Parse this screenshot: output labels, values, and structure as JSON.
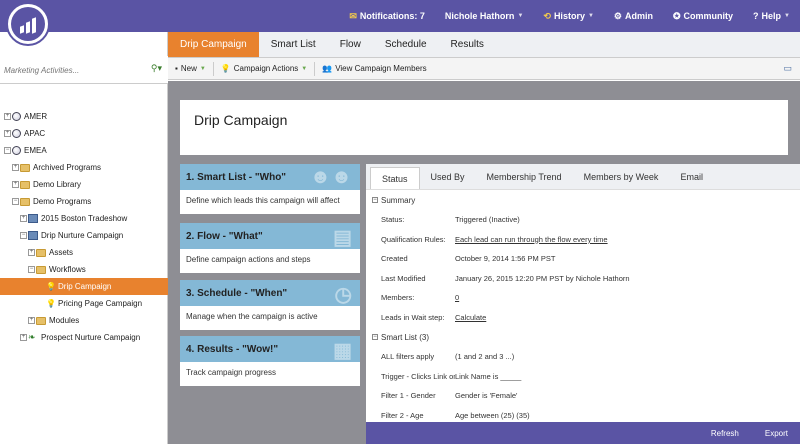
{
  "topnav": {
    "notifications": "Notifications: 7",
    "user": "Nichole Hathorn",
    "history": "History",
    "admin": "Admin",
    "community": "Community",
    "help": "Help"
  },
  "sidebar": {
    "search_placeholder": "Marketing Activities...",
    "items": [
      {
        "label": "AMER"
      },
      {
        "label": "APAC"
      },
      {
        "label": "EMEA"
      },
      {
        "label": "Archived Programs"
      },
      {
        "label": "Demo Library"
      },
      {
        "label": "Demo Programs"
      },
      {
        "label": "2015 Boston Tradeshow"
      },
      {
        "label": "Drip Nurture Campaign"
      },
      {
        "label": "Assets"
      },
      {
        "label": "Workflows"
      },
      {
        "label": "Drip Campaign"
      },
      {
        "label": "Pricing Page Campaign"
      },
      {
        "label": "Modules"
      },
      {
        "label": "Prospect Nurture Campaign"
      }
    ]
  },
  "tabs": [
    "Drip Campaign",
    "Smart List",
    "Flow",
    "Schedule",
    "Results"
  ],
  "toolbar": {
    "new": "New",
    "campaign_actions": "Campaign Actions",
    "view_members": "View Campaign Members"
  },
  "header": {
    "title": "Drip Campaign"
  },
  "steps": [
    {
      "title": "1. Smart List - \"Who\"",
      "desc": "Define which leads this campaign will affect"
    },
    {
      "title": "2. Flow - \"What\"",
      "desc": "Define campaign actions and steps"
    },
    {
      "title": "3. Schedule - \"When\"",
      "desc": "Manage when the campaign is active"
    },
    {
      "title": "4. Results - \"Wow!\"",
      "desc": "Track campaign progress"
    }
  ],
  "detail": {
    "tabs": [
      "Status",
      "Used By",
      "Membership Trend",
      "Members by Week",
      "Email"
    ],
    "summary_label": "Summary",
    "summary": [
      {
        "k": "Status:",
        "v": "Triggered (Inactive)"
      },
      {
        "k": "Qualification Rules:",
        "v": "Each lead can run through the flow every time"
      },
      {
        "k": "Created",
        "v": "October 9, 2014 1:56 PM PST"
      },
      {
        "k": "Last Modified",
        "v": "January 26, 2015 12:20 PM PST by Nichole Hathorn"
      },
      {
        "k": "Members:",
        "v": "0"
      },
      {
        "k": "Leads in Wait step:",
        "v": "Calculate"
      }
    ],
    "smartlist_label": "Smart List (3)",
    "smartlist": [
      {
        "k": "ALL filters apply",
        "v": "(1 and 2 and 3 ...)"
      },
      {
        "k": "Trigger - Clicks Link on ...",
        "v": "Link Name is _____"
      },
      {
        "k": "Filter 1 - Gender",
        "v": "Gender is 'Female'"
      },
      {
        "k": "Filter 2 - Age",
        "v": "Age between (25) (35)"
      }
    ],
    "footer": {
      "refresh": "Refresh",
      "export": "Export"
    }
  }
}
